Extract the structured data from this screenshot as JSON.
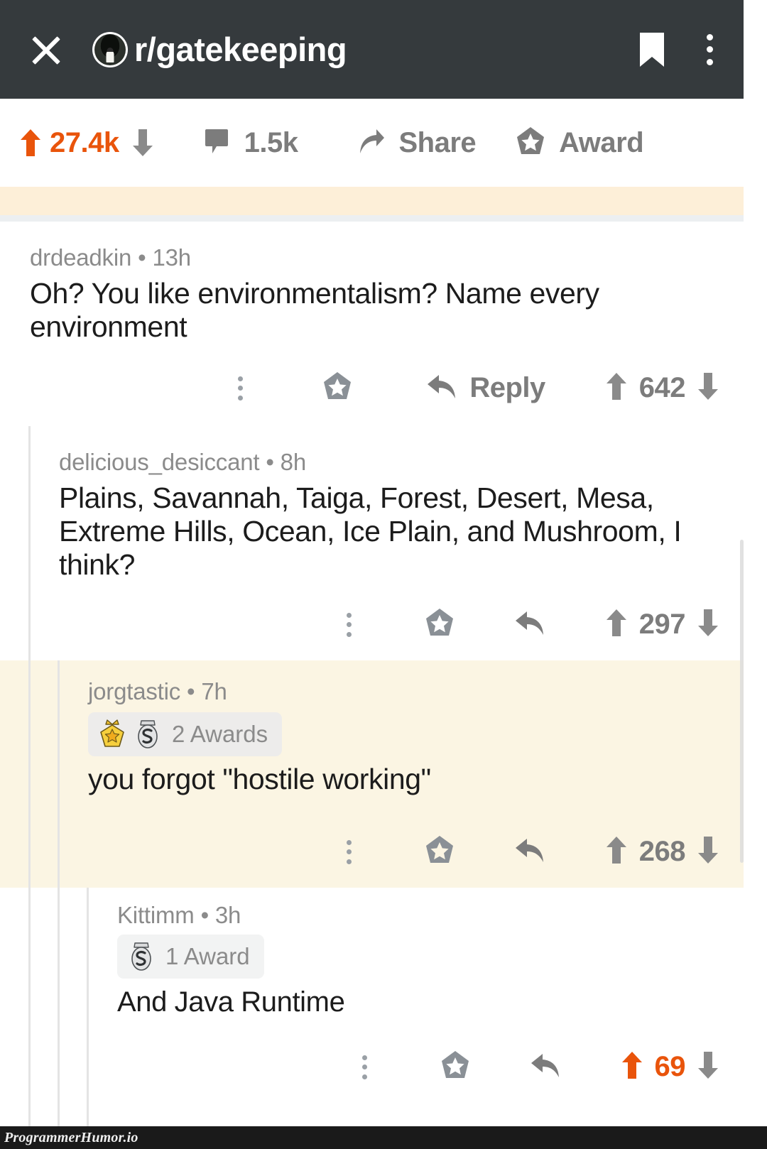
{
  "appbar": {
    "close_icon": "close-icon",
    "avatar_icon": "subreddit-avatar",
    "subreddit": "r/gatekeeping",
    "bookmark_icon": "bookmark-icon",
    "overflow_icon": "kebab-menu-icon"
  },
  "post_actions": {
    "upvote_icon": "upvote-arrow",
    "score": "27.4k",
    "downvote_icon": "downvote-arrow",
    "comment_icon": "comment-bubble",
    "comment_count": "1.5k",
    "share_icon": "share-arrow",
    "share_label": "Share",
    "award_icon": "award-star",
    "award_label": "Award"
  },
  "comments": [
    {
      "author": "drdeadkin",
      "separator": "•",
      "age": "13h",
      "text": "Oh? You like environmentalism? Name every environment",
      "awards": null,
      "reply_label": "Reply",
      "score": "642",
      "score_highlighted": false,
      "depth": 0,
      "highlighted": false
    },
    {
      "author": "delicious_desiccant",
      "separator": "•",
      "age": "8h",
      "text": "Plains, Savannah, Taiga, Forest, Desert, Mesa, Extreme Hills, Ocean, Ice Plain, and Mushroom, I think?",
      "awards": null,
      "reply_label": "",
      "score": "297",
      "score_highlighted": false,
      "depth": 1,
      "highlighted": false
    },
    {
      "author": "jorgtastic",
      "separator": "•",
      "age": "7h",
      "text": "you forgot \"hostile working\"",
      "awards": {
        "label": "2 Awards",
        "badges": [
          "gold-star-award-badge",
          "silver-s-award-badge"
        ]
      },
      "reply_label": "",
      "score": "268",
      "score_highlighted": false,
      "depth": 2,
      "highlighted": true
    },
    {
      "author": "Kittimm",
      "separator": "•",
      "age": "3h",
      "text": "And Java Runtime",
      "awards": {
        "label": "1 Award",
        "badges": [
          "silver-s-award-badge"
        ]
      },
      "reply_label": "",
      "score": "69",
      "score_highlighted": true,
      "depth": 3,
      "highlighted": false
    }
  ],
  "watermark": {
    "text": "ProgrammerHumor.io"
  },
  "colors": {
    "appbar_bg": "#353a3d",
    "upvote_orange": "#e9540b",
    "muted_text": "#7c7c7c",
    "meta_text": "#8b8b8b",
    "highlight_cream": "#fbf5e3",
    "strip_cream": "#fdefd8",
    "strip_gray": "#eceff1",
    "thread_line": "#e4e4e4"
  }
}
